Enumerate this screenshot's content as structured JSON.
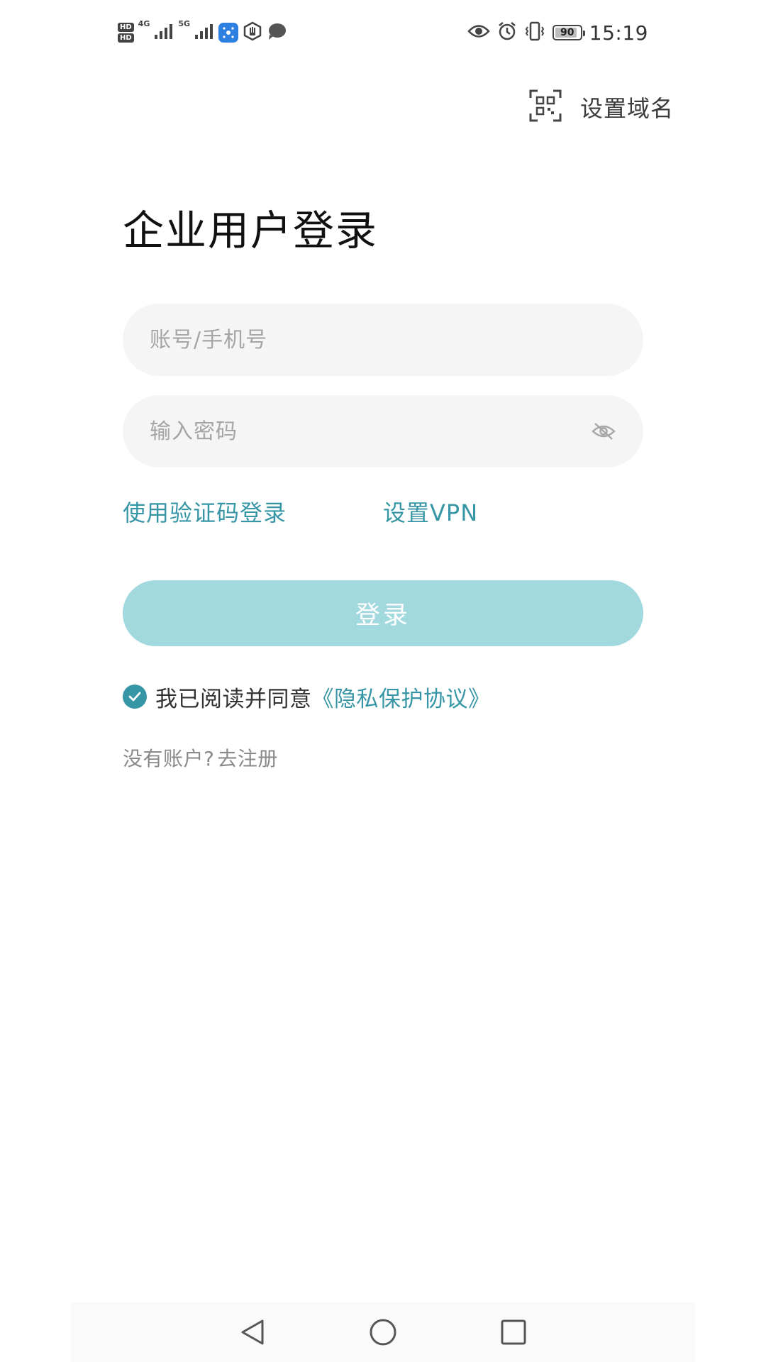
{
  "status_bar": {
    "sim1_badge": "HD",
    "sim2_badge": "HD",
    "sim1_network": "4G",
    "sim2_network": "5G",
    "battery_percent": "90",
    "battery_level": 0.9,
    "time": "15:19",
    "icons": [
      "hd-icon",
      "signal-icon",
      "tp-link-app-icon",
      "hand-icon",
      "message-icon",
      "eye-icon",
      "alarm-icon",
      "vibrate-icon",
      "battery-icon"
    ]
  },
  "header": {
    "domain_label": "设置域名",
    "domain_icon": "qr-scan-icon"
  },
  "main": {
    "title": "企业用户登录",
    "account_placeholder": "账号/手机号",
    "password_placeholder": "输入密码",
    "password_toggle_icon": "eye-off-icon",
    "code_login_link": "使用验证码登录",
    "vpn_link": "设置VPN",
    "login_button": "登录",
    "agreement_checked": true,
    "agreement_text": "我已阅读并同意",
    "agreement_link": "《隐私保护协议》",
    "register_prompt": "没有账户?",
    "register_link": "去注册"
  },
  "colors": {
    "accent": "#3796a6",
    "login_button_bg": "#a1d9df",
    "input_bg": "#f5f5f5",
    "title_text": "#111111",
    "muted_text": "#8a8a8a"
  },
  "nav_bar": {
    "icons": [
      "back-triangle-icon",
      "home-circle-icon",
      "recent-square-icon"
    ]
  }
}
